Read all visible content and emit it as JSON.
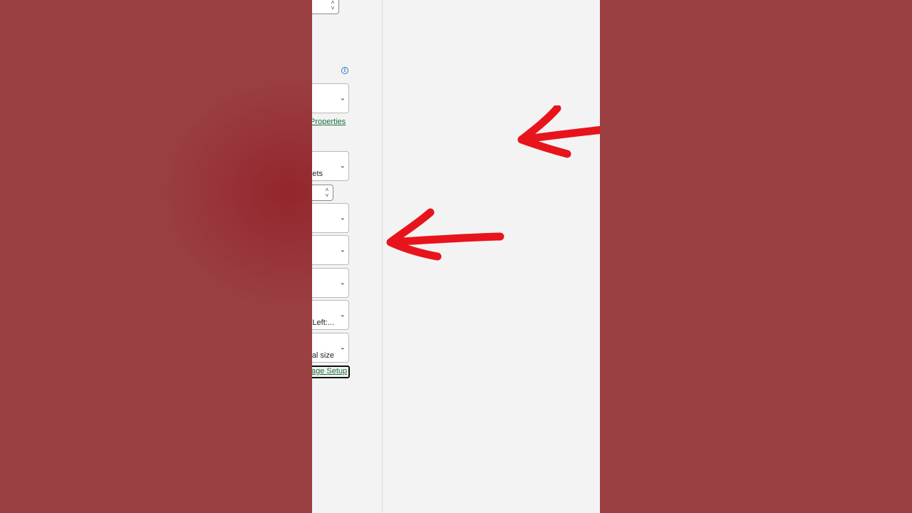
{
  "print_settings": {
    "top_spinner": {
      "value": ""
    },
    "printer_properties_link": "Properties",
    "print_scope_dropdown": {
      "label": "eets"
    },
    "pages_spinner": {
      "value": ""
    },
    "dropdowns": [
      {
        "label": ""
      },
      {
        "label": ""
      },
      {
        "label": ""
      },
      {
        "label": "Left:..."
      },
      {
        "label": "al size"
      }
    ],
    "page_setup_link": "age Setup"
  },
  "annotations": {
    "arrow_color": "#e8141c"
  },
  "icons": {
    "info": "info-icon",
    "chevron": "chevron-down-icon",
    "spinner_up": "chevron-up-icon"
  }
}
